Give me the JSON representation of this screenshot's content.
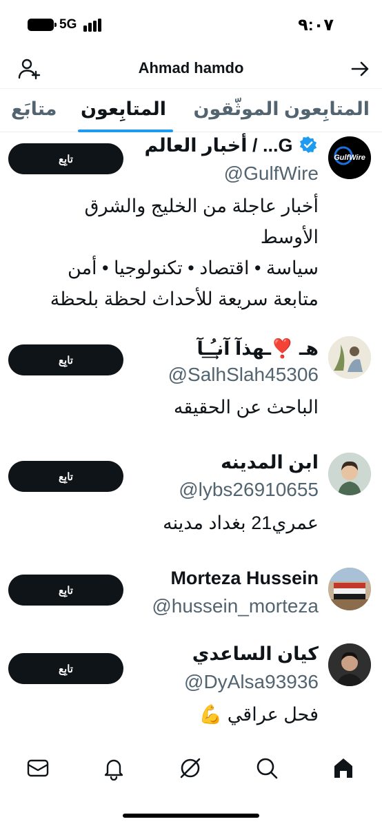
{
  "status_bar": {
    "network": "5G",
    "time": "٩:٠٧"
  },
  "header": {
    "title": "Ahmad hamdo"
  },
  "tabs": {
    "verified_followers": "المتابِعون الموثّقون",
    "followers": "المتابِعون",
    "following": "متابَع"
  },
  "users": [
    {
      "name": "أخبار العالم / ...G",
      "handle": "@GulfWire",
      "bio_lines": [
        "أخبار عاجلة من الخليج والشرق",
        "الأوسط",
        "سياسة • اقتصاد • تكنولوجيا • أمن",
        "متابعة سريعة للأحداث لحظة بلحظة"
      ],
      "avatar_text": "GulfWire",
      "follow_label": "تابِع"
    },
    {
      "name": "هـ ❣️ـهذآ آنـُ͢ـآ",
      "handle": "@SalhSlah45306",
      "bio_lines": [
        "الباحث عن الحقيقه"
      ],
      "follow_label": "تابِع"
    },
    {
      "name": "ابن المدينه",
      "handle": "@lybs26910655",
      "bio_lines": [
        "عمري21 بغداد مدينه"
      ],
      "follow_label": "تابِع"
    },
    {
      "name": "Morteza Hussein",
      "handle": "@hussein_morteza",
      "bio_lines": [],
      "follow_label": "تابِع"
    },
    {
      "name": "كيان الساعدي",
      "handle": "@DyAlsa93936",
      "bio_lines": [
        "فحل عراقي 💪"
      ],
      "follow_label": "تابِع"
    }
  ],
  "nav": [
    "mail-icon",
    "bell-icon",
    "grok-icon",
    "search-icon",
    "home-icon"
  ],
  "colors": {
    "accent": "#1d9bf0",
    "text": "#0f1419",
    "secondary": "#536471",
    "button": "#0f1419"
  }
}
